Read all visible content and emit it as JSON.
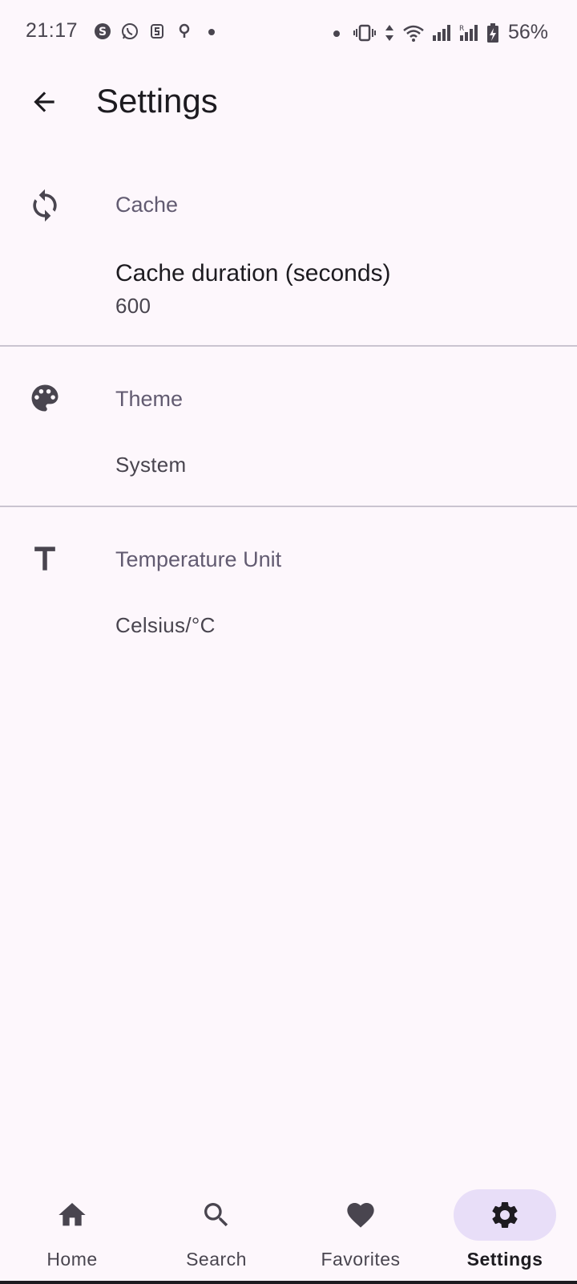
{
  "colors": {
    "background": "#fdf7fc",
    "icon": "#49454f",
    "heading": "#625b71",
    "divider": "#cac4d0",
    "nav_active_pill": "#e8def8"
  },
  "status_bar": {
    "time": "21:17",
    "left_icons": [
      "skype-icon",
      "whatsapp-icon",
      "s-app-icon",
      "location-icon",
      "dot-icon"
    ],
    "right_icons": [
      "dot-icon",
      "vibrate-icon",
      "data-arrows-icon",
      "wifi-icon",
      "signal-icon",
      "signal-r-icon",
      "battery-charging-icon"
    ],
    "battery": "56%"
  },
  "top_bar": {
    "back_icon": "arrow-back-icon",
    "title": "Settings"
  },
  "sections": {
    "cache": {
      "icon": "sync-icon",
      "heading": "Cache",
      "item_title": "Cache duration (seconds)",
      "item_value": "600"
    },
    "theme": {
      "icon": "palette-icon",
      "heading": "Theme",
      "item_value": "System"
    },
    "temperature": {
      "icon": "text-t-icon",
      "heading": "Temperature Unit",
      "item_value": "Celsius/°C"
    }
  },
  "bottom_nav": {
    "items": [
      {
        "label": "Home",
        "icon": "home-icon",
        "active": false
      },
      {
        "label": "Search",
        "icon": "search-icon",
        "active": false
      },
      {
        "label": "Favorites",
        "icon": "heart-icon",
        "active": false
      },
      {
        "label": "Settings",
        "icon": "gear-icon",
        "active": true
      }
    ]
  }
}
